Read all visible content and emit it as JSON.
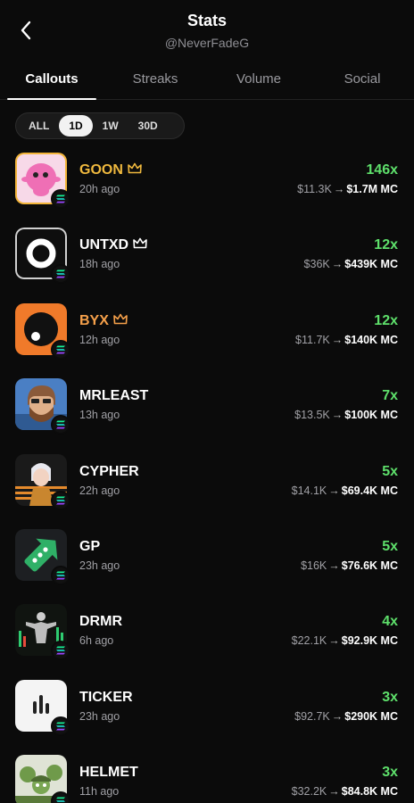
{
  "header": {
    "title": "Stats",
    "subtitle": "@NeverFadeG"
  },
  "tabs": [
    {
      "label": "Callouts",
      "active": true
    },
    {
      "label": "Streaks",
      "active": false
    },
    {
      "label": "Volume",
      "active": false
    },
    {
      "label": "Social",
      "active": false
    }
  ],
  "filters": [
    {
      "label": "ALL",
      "active": false
    },
    {
      "label": "1D",
      "active": true
    },
    {
      "label": "1W",
      "active": false
    },
    {
      "label": "30D",
      "active": false
    }
  ],
  "colors": {
    "gold": "#f0b93e",
    "green": "#5ee06b",
    "orange": "#f5a04a",
    "muted": "#a0a0a5"
  },
  "callouts": [
    {
      "name": "GOON",
      "crown": true,
      "name_color": "#f0b93e",
      "time": "20h ago",
      "multiplier": "146x",
      "from": "$11.3K",
      "to": "$1.7M MC",
      "icon": "pink-blob-icon"
    },
    {
      "name": "UNTXD",
      "crown": true,
      "name_color": "#ffffff",
      "time": "18h ago",
      "multiplier": "12x",
      "from": "$36K",
      "to": "$439K MC",
      "icon": "ring-logo-icon"
    },
    {
      "name": "BYX",
      "crown": true,
      "name_color": "#f5a04a",
      "time": "12h ago",
      "multiplier": "12x",
      "from": "$11.7K",
      "to": "$140K MC",
      "icon": "orange-eye-icon"
    },
    {
      "name": "MRLEAST",
      "crown": false,
      "name_color": "#ffffff",
      "time": "13h ago",
      "multiplier": "7x",
      "from": "$13.5K",
      "to": "$100K MC",
      "icon": "bearded-cartoon-icon"
    },
    {
      "name": "CYPHER",
      "crown": false,
      "name_color": "#ffffff",
      "time": "22h ago",
      "multiplier": "5x",
      "from": "$14.1K",
      "to": "$69.4K MC",
      "icon": "anime-character-icon"
    },
    {
      "name": "GP",
      "crown": false,
      "name_color": "#ffffff",
      "time": "23h ago",
      "multiplier": "5x",
      "from": "$16K",
      "to": "$76.6K MC",
      "icon": "green-arrow-icon"
    },
    {
      "name": "DRMR",
      "crown": false,
      "name_color": "#ffffff",
      "time": "6h ago",
      "multiplier": "4x",
      "from": "$22.1K",
      "to": "$92.9K MC",
      "icon": "bodybuilder-chart-icon"
    },
    {
      "name": "TICKER",
      "crown": false,
      "name_color": "#ffffff",
      "time": "23h ago",
      "multiplier": "3x",
      "from": "$92.7K",
      "to": "$290K MC",
      "icon": "bars-logo-icon"
    },
    {
      "name": "HELMET",
      "crown": false,
      "name_color": "#ffffff",
      "time": "11h ago",
      "multiplier": "3x",
      "from": "$32.2K",
      "to": "$84.8K MC",
      "icon": "frog-soldiers-icon"
    }
  ]
}
